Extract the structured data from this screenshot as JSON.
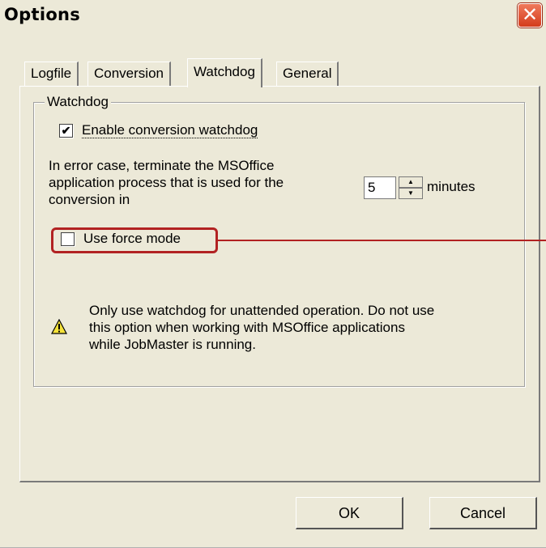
{
  "window": {
    "title": "Options",
    "close_glyph": "✕"
  },
  "tabs": [
    {
      "label": "Logfile",
      "active": false
    },
    {
      "label": "Conversion",
      "active": false
    },
    {
      "label": "Watchdog",
      "active": true
    },
    {
      "label": "General",
      "active": false
    }
  ],
  "watchdog": {
    "group_label": "Watchdog",
    "enable_checkbox": {
      "label": "Enable conversion watchdog",
      "checked": true,
      "check_glyph": "✔"
    },
    "terminate_text": "In error case, terminate the MSOffice\napplication process that is used for the\nconversion in",
    "minutes_value": "5",
    "minutes_label": "minutes",
    "force_mode_checkbox": {
      "label": "Use force mode",
      "checked": false
    },
    "warning_text": "Only use watchdog for unattended operation. Do not use\nthis option when working with MSOffice applications\nwhile JobMaster is running."
  },
  "buttons": {
    "ok": "OK",
    "cancel": "Cancel"
  },
  "icons": {
    "close": "close-icon",
    "warning": "warning-icon",
    "spin_up": "spin-up-icon",
    "spin_down": "spin-down-icon"
  },
  "colors": {
    "dialog_bg": "#ece9d8",
    "annotation": "#b22222",
    "close_button": "#d43c1c"
  }
}
